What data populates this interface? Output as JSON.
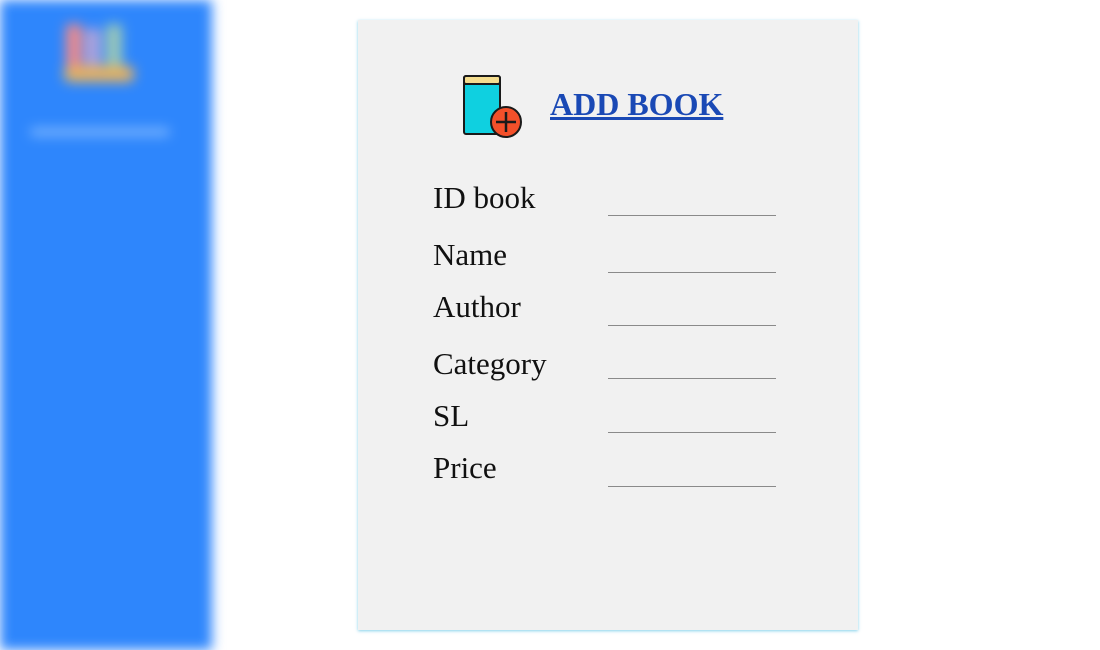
{
  "sidebar": {
    "background": "#2e86fc",
    "logo_icon": "books-logo-icon"
  },
  "header": {
    "title": "ADD BOOK",
    "icon": "book-add-icon",
    "title_color": "#1a49b5"
  },
  "form": {
    "fields": [
      {
        "label": "ID book",
        "value": ""
      },
      {
        "label": "Name",
        "value": ""
      },
      {
        "label": "Author",
        "value": ""
      },
      {
        "label": "Category",
        "value": ""
      },
      {
        "label": "SL",
        "value": ""
      },
      {
        "label": "Price",
        "value": ""
      }
    ]
  }
}
